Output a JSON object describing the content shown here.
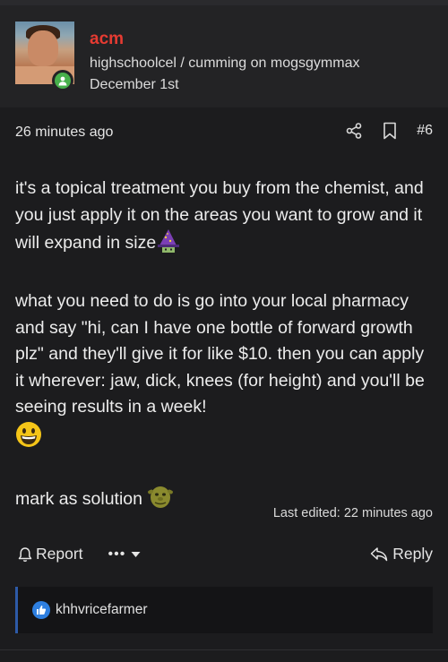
{
  "author": {
    "username": "acm",
    "user_title": "highschoolcel / cumming on mogsgymmax",
    "joined": "December 1st",
    "status": "online",
    "username_color": "#e63b32",
    "online_color": "#47b04b"
  },
  "post": {
    "time": "26 minutes ago",
    "number": "#6",
    "paragraphs": [
      {
        "text": "it's a topical treatment you buy from the chemist, and you just apply it on the areas you want to grow and it will expand in size",
        "emoji": "wizard-emoji"
      },
      {
        "text": "what you need to do is go into your local pharmacy and say \"hi, can I have one bottle of forward growth plz\" and they'll give it for like $10. then you can apply it wherever: jaw, dick, knees (for height) and you'll be seeing results in a week!",
        "emoji": "grinning-emoji"
      },
      {
        "text": "mark as solution",
        "emoji": "shrek-emoji"
      }
    ],
    "last_edited": "Last edited: 22 minutes ago"
  },
  "actions": {
    "share_icon": "share-icon",
    "bookmark_icon": "bookmark-icon",
    "report_label": "Report",
    "more_label": "•••",
    "reply_label": "Reply"
  },
  "reactions": {
    "icon": "thumbs-up-icon",
    "users": "khhvricefarmer",
    "accent": "#2e7fe0"
  }
}
